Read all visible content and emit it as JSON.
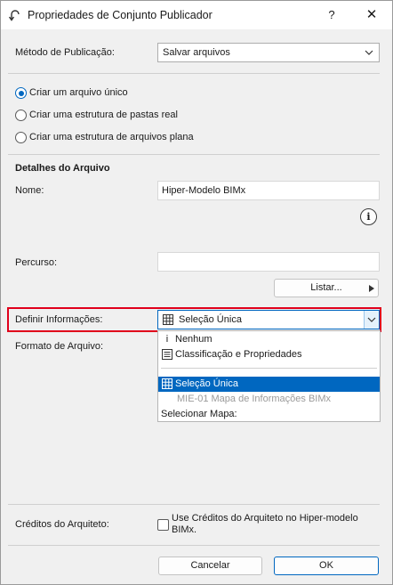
{
  "window": {
    "title": "Propriedades de Conjunto Publicador",
    "help_label": "?",
    "close_label": "✕"
  },
  "publish_method": {
    "label": "Método de Publicação:",
    "value": "Salvar arquivos"
  },
  "radio_options": [
    {
      "label": "Criar um arquivo único",
      "checked": true
    },
    {
      "label": "Criar uma estrutura de pastas real",
      "checked": false
    },
    {
      "label": "Criar uma estrutura de arquivos plana",
      "checked": false
    }
  ],
  "file_details": {
    "heading": "Detalhes do Arquivo",
    "name_label": "Nome:",
    "name_value": "Hiper-Modelo BIMx",
    "info_icon_glyph": "i",
    "path_label": "Percurso:",
    "path_value": "",
    "browse_label": "Listar..."
  },
  "define_info": {
    "label": "Definir Informações:",
    "value": "Seleção Única",
    "format_label": "Formato de Arquivo:"
  },
  "dropdown": {
    "items": [
      {
        "label": "Nenhum",
        "icon": "info-icon"
      },
      {
        "label": "Classificação e Propriedades",
        "icon": "document-list-icon"
      },
      {
        "label": "Seleção Única",
        "icon": "grid-table-icon",
        "selected": true
      },
      {
        "label": "MIE-01 Mapa de Informações BIMx",
        "disabled": true
      },
      {
        "label": "Selecionar Mapa:"
      }
    ]
  },
  "architect_credits": {
    "label": "Créditos do Arquiteto:",
    "checkbox_label": "Use Créditos do Arquiteto no Hiper-modelo BIMx.",
    "checked": false
  },
  "footer": {
    "cancel_label": "Cancelar",
    "ok_label": "OK"
  },
  "colors": {
    "accent": "#0067c0",
    "highlight": "#e0001b"
  }
}
